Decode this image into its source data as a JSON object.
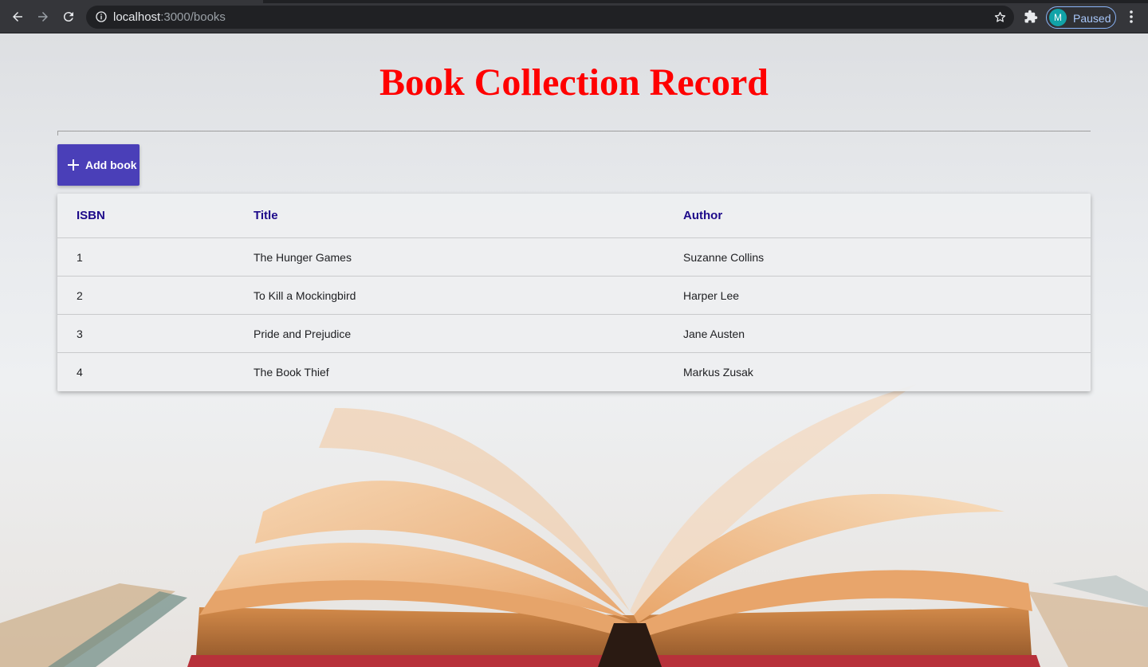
{
  "browser": {
    "url_host": "localhost",
    "url_path": ":3000/books",
    "profile_initial": "M",
    "profile_status": "Paused"
  },
  "page": {
    "title": "Book Collection Record",
    "add_button_label": "Add book"
  },
  "table": {
    "headers": [
      "ISBN",
      "Title",
      "Author"
    ],
    "rows": [
      [
        "1",
        "The Hunger Games",
        "Suzanne Collins"
      ],
      [
        "2",
        "To Kill a Mockingbird",
        "Harper Lee"
      ],
      [
        "3",
        "Pride and Prejudice",
        "Jane Austen"
      ],
      [
        "4",
        "The Book Thief",
        "Markus Zusak"
      ]
    ]
  },
  "colors": {
    "title": "#ff0000",
    "button": "#4a3fb8",
    "header_text": "#1d0a8a"
  },
  "icons": [
    "back-icon",
    "forward-icon",
    "reload-icon",
    "info-icon",
    "star-icon",
    "extensions-icon",
    "kebab-menu-icon",
    "plus-icon",
    "open-book-image"
  ]
}
